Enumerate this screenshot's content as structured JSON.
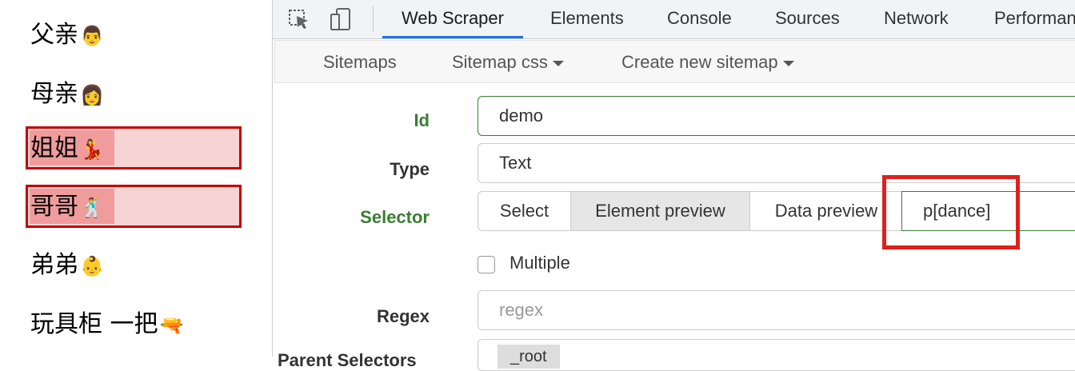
{
  "page": {
    "items": [
      {
        "text": "父亲",
        "emoji": "👨"
      },
      {
        "text": "母亲",
        "emoji": "👩"
      },
      {
        "text": "姐姐",
        "emoji": "💃"
      },
      {
        "text": "哥哥",
        "emoji": "🕺"
      },
      {
        "text": "弟弟",
        "emoji": "👶"
      },
      {
        "text": "玩具柜 一把",
        "emoji": "🔫"
      }
    ]
  },
  "devtools": {
    "tabs": [
      "Web Scraper",
      "Elements",
      "Console",
      "Sources",
      "Network",
      "Performan"
    ],
    "active_tab": "Web Scraper",
    "icons": [
      "inspect-cursor-icon",
      "device-toggle-icon"
    ]
  },
  "subnav": {
    "sitemaps": "Sitemaps",
    "sitemap_css": "Sitemap css",
    "create_new": "Create new sitemap"
  },
  "form": {
    "id_label": "Id",
    "id_value": "demo",
    "type_label": "Type",
    "type_value": "Text",
    "selector_label": "Selector",
    "select_btn": "Select",
    "element_preview_btn": "Element preview",
    "data_preview_btn": "Data preview",
    "selector_value": "p[dance]",
    "multiple_label": "Multiple",
    "regex_label": "Regex",
    "regex_placeholder": "regex",
    "parent_label": "Parent Selectors",
    "root_value": "_root"
  },
  "colors": {
    "accent_green": "#3a7d34",
    "highlight_red": "#e0201b",
    "tab_underline": "#1a73e8"
  }
}
